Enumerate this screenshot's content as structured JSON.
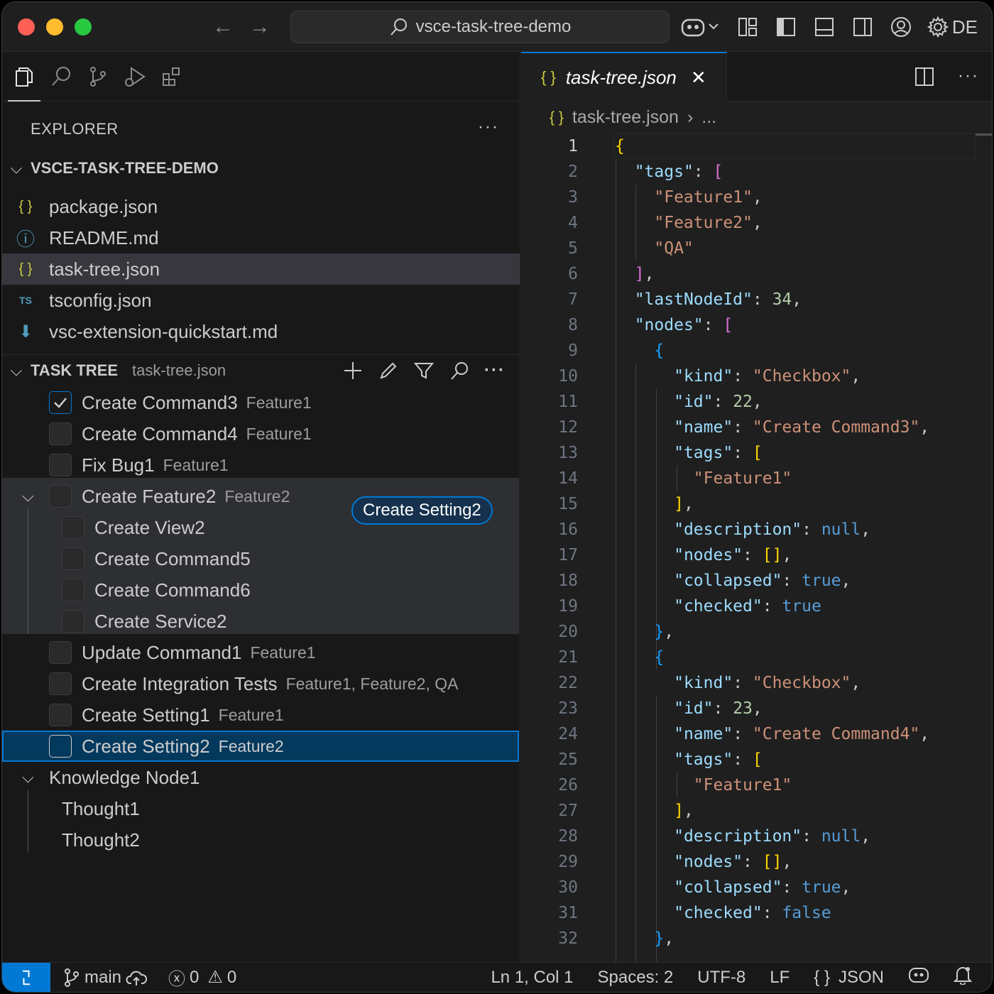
{
  "title": {
    "search_text": "vsce-task-tree-demo",
    "account_label": "DE"
  },
  "activity_bar": {
    "items": [
      "explorer",
      "search",
      "source-control",
      "run-debug",
      "extensions"
    ]
  },
  "explorer": {
    "header": "EXPLORER",
    "folder_name": "VSCE-TASK-TREE-DEMO",
    "files": [
      {
        "name": "package.json",
        "icon": "json-icon",
        "icon_glyph": "{ }",
        "selected": false
      },
      {
        "name": "README.md",
        "icon": "info-icon",
        "icon_glyph": "ⓘ",
        "selected": false
      },
      {
        "name": "task-tree.json",
        "icon": "json-icon",
        "icon_glyph": "{ }",
        "selected": true
      },
      {
        "name": "tsconfig.json",
        "icon": "typescript-icon",
        "icon_glyph": "TS",
        "selected": false
      },
      {
        "name": "vsc-extension-quickstart.md",
        "icon": "download-arrow-icon",
        "icon_glyph": "⬇",
        "selected": false
      }
    ]
  },
  "task_tree": {
    "header": "TASK TREE",
    "subtitle": "task-tree.json",
    "hover_tooltip": "Create Setting2",
    "rows": [
      {
        "label": "Create Command3",
        "desc": "Feature1",
        "checked": true
      },
      {
        "label": "Create Command4",
        "desc": "Feature1",
        "checked": false
      },
      {
        "label": "Fix Bug1",
        "desc": "Feature1",
        "checked": false
      },
      {
        "label": "Create Feature2",
        "desc": "Feature2",
        "checked": false
      },
      {
        "label": "Create View2",
        "desc": "",
        "checked": false
      },
      {
        "label": "Create Command5",
        "desc": "",
        "checked": false
      },
      {
        "label": "Create Command6",
        "desc": "",
        "checked": false
      },
      {
        "label": "Create Service2",
        "desc": "",
        "checked": false
      },
      {
        "label": "Update Command1",
        "desc": "Feature1",
        "checked": false
      },
      {
        "label": "Create Integration Tests",
        "desc": "Feature1, Feature2, QA",
        "checked": false
      },
      {
        "label": "Create Setting1",
        "desc": "Feature1",
        "checked": false
      },
      {
        "label": "Create Setting2",
        "desc": "Feature2",
        "checked": false
      },
      {
        "label": "Knowledge Node1",
        "desc": "",
        "checked": false
      },
      {
        "label": "Thought1",
        "desc": "",
        "checked": false
      },
      {
        "label": "Thought2",
        "desc": "",
        "checked": false
      }
    ]
  },
  "editor": {
    "tab_label": "task-tree.json",
    "tab_icon": "{ }",
    "breadcrumb_file": "task-tree.json",
    "breadcrumb_more": "...",
    "line_numbers": [
      "1",
      "2",
      "3",
      "4",
      "5",
      "6",
      "7",
      "8",
      "9",
      "10",
      "11",
      "12",
      "13",
      "14",
      "15",
      "16",
      "17",
      "18",
      "19",
      "20",
      "21",
      "22",
      "23",
      "24",
      "25",
      "26",
      "27",
      "28",
      "29",
      "30",
      "31",
      "32"
    ],
    "lines": [
      "{",
      "  \"tags\": [",
      "    \"Feature1\",",
      "    \"Feature2\",",
      "    \"QA\"",
      "  ],",
      "  \"lastNodeId\": 34,",
      "  \"nodes\": [",
      "    {",
      "      \"kind\": \"Checkbox\",",
      "      \"id\": 22,",
      "      \"name\": \"Create Command3\",",
      "      \"tags\": [",
      "        \"Feature1\"",
      "      ],",
      "      \"description\": null,",
      "      \"nodes\": [],",
      "      \"collapsed\": true,",
      "      \"checked\": true",
      "    },",
      "    {",
      "      \"kind\": \"Checkbox\",",
      "      \"id\": 23,",
      "      \"name\": \"Create Command4\",",
      "      \"tags\": [",
      "        \"Feature1\"",
      "      ],",
      "      \"description\": null,",
      "      \"nodes\": [],",
      "      \"collapsed\": true,",
      "      \"checked\": false",
      "    },"
    ]
  },
  "statusbar": {
    "branch": "main",
    "errors": "0",
    "warnings": "0",
    "cursor": "Ln 1, Col 1",
    "spaces": "Spaces: 2",
    "encoding": "UTF-8",
    "eol": "LF",
    "language": "JSON",
    "language_icon": "{ }"
  },
  "colors": {
    "accent": "#0078d4",
    "string": "#ce9178",
    "key": "#9cdcfe",
    "number": "#b5cea8",
    "keyword": "#569cd6"
  }
}
